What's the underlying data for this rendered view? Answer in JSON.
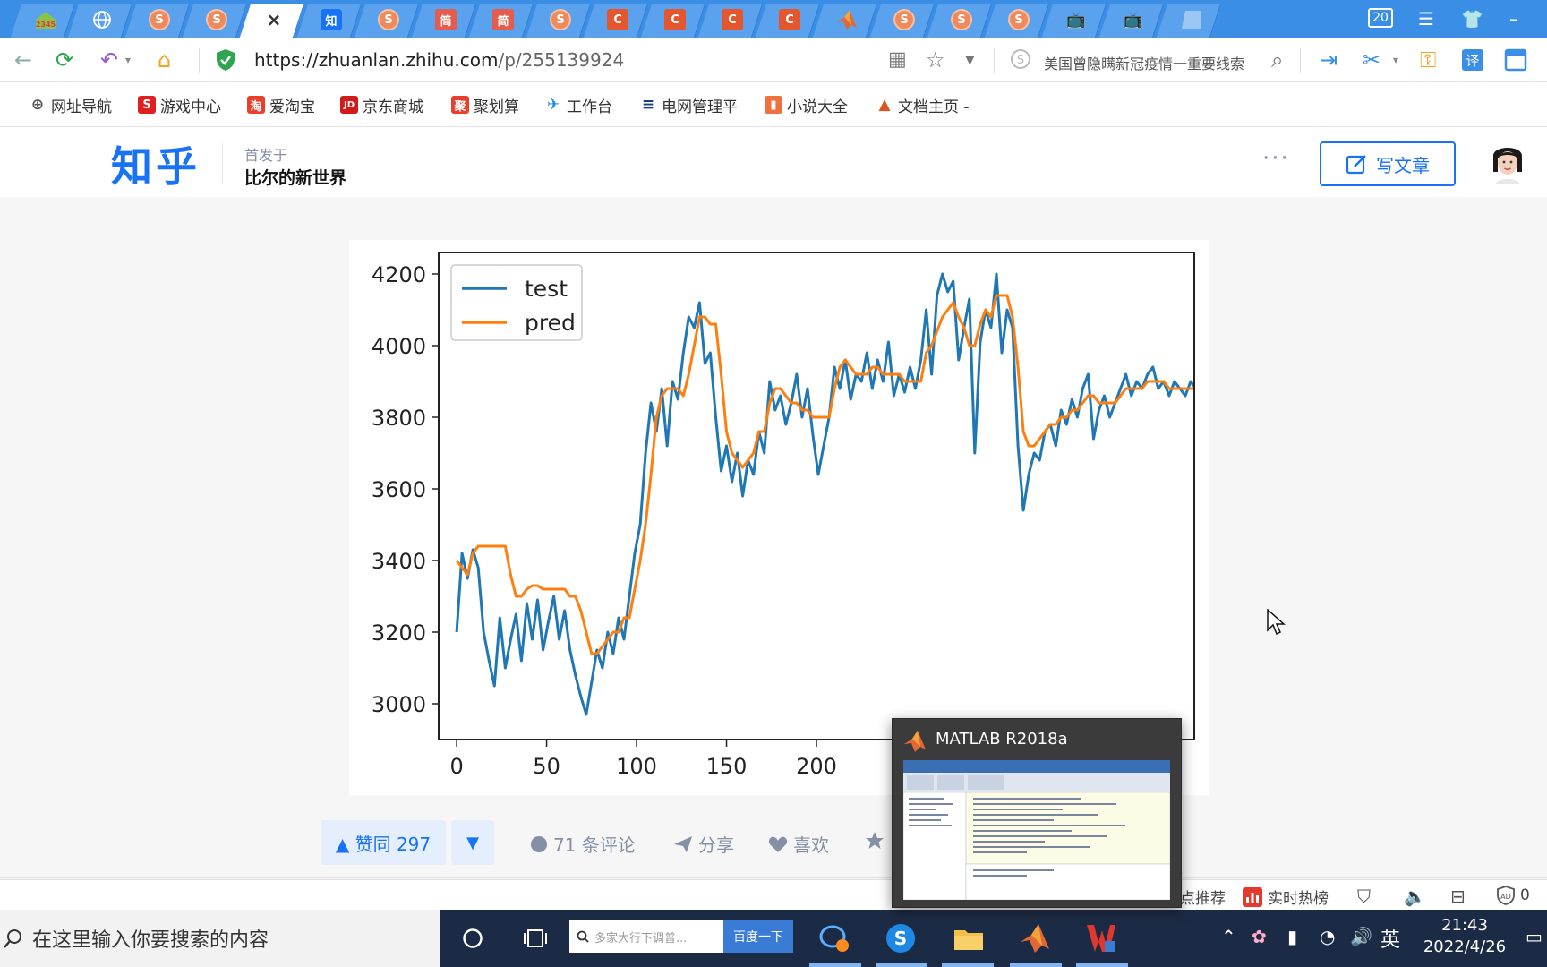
{
  "browser": {
    "tab_count": "20",
    "tabs": [
      {
        "icon": "home-2345",
        "text": ""
      },
      {
        "icon": "globe",
        "text": ""
      },
      {
        "icon": "sogou",
        "text": "S"
      },
      {
        "icon": "sogou",
        "text": "S"
      },
      {
        "icon": "close",
        "text": "×"
      },
      {
        "icon": "zhihu",
        "text": "知"
      },
      {
        "icon": "sogou",
        "text": "S"
      },
      {
        "icon": "jianshu",
        "text": "简"
      },
      {
        "icon": "jianshu",
        "text": "简"
      },
      {
        "icon": "sogou",
        "text": "S"
      },
      {
        "icon": "csdn",
        "text": "C"
      },
      {
        "icon": "csdn",
        "text": "C"
      },
      {
        "icon": "csdn",
        "text": "C"
      },
      {
        "icon": "csdn",
        "text": "C"
      },
      {
        "icon": "matlab",
        "text": ""
      },
      {
        "icon": "sogou",
        "text": "S"
      },
      {
        "icon": "sogou",
        "text": "S"
      },
      {
        "icon": "sogou",
        "text": "S"
      },
      {
        "icon": "bilibili",
        "text": "📺"
      },
      {
        "icon": "bilibili",
        "text": "📺"
      },
      {
        "icon": "blank",
        "text": ""
      }
    ],
    "url_host": "https://zhuanlan.zhihu.com",
    "url_path": "/p/255139924",
    "search_text": "美国曾隐瞒新冠疫情一重要线索"
  },
  "bookmarks": [
    {
      "label": "网址导航",
      "icon": "globe-icon",
      "icon_char": "⊕",
      "color": "#555555"
    },
    {
      "label": "游戏中心",
      "icon": "game-icon",
      "icon_char": "S",
      "color": "#e02020"
    },
    {
      "label": "爱淘宝",
      "icon": "taobao-icon",
      "icon_char": "淘",
      "color": "#e8402c"
    },
    {
      "label": "京东商城",
      "icon": "jd-icon",
      "icon_char": "JD",
      "color": "#d21a1a"
    },
    {
      "label": "聚划算",
      "icon": "juhuasuan-icon",
      "icon_char": "聚",
      "color": "#e8402c"
    },
    {
      "label": "工作台",
      "icon": "plane-icon",
      "icon_char": "✈",
      "color": "#1e88e5"
    },
    {
      "label": "电网管理平",
      "icon": "grid-icon",
      "icon_char": "≡",
      "color": "#1a3c8c"
    },
    {
      "label": "小说大全",
      "icon": "novel-icon",
      "icon_char": "▮",
      "color": "#f07040"
    },
    {
      "label": "文档主页 -",
      "icon": "matlab-icon",
      "icon_char": "▲",
      "color": "#d9541e"
    }
  ],
  "zhihu": {
    "logo": "知乎",
    "published_in": "首发于",
    "column": "比尔的新世界",
    "more": "···",
    "write_button": "写文章"
  },
  "chart_data": {
    "type": "line",
    "xlim": [
      -10,
      410
    ],
    "ylim": [
      2900,
      4260
    ],
    "x_ticks": [
      0,
      50,
      100,
      150,
      200
    ],
    "y_ticks": [
      3000,
      3200,
      3400,
      3600,
      3800,
      4000,
      4200
    ],
    "x_tick_labels": [
      "0",
      "50",
      "100",
      "150",
      "200"
    ],
    "y_tick_labels": [
      "3000",
      "3200",
      "3400",
      "3600",
      "3800",
      "4000",
      "4200"
    ],
    "legend_position": "upper-left",
    "series": [
      {
        "name": "test",
        "color": "#1f77b4",
        "x": [
          0,
          3,
          6,
          9,
          12,
          15,
          18,
          21,
          24,
          27,
          30,
          33,
          36,
          39,
          42,
          45,
          48,
          51,
          54,
          57,
          60,
          63,
          66,
          69,
          72,
          75,
          78,
          81,
          84,
          87,
          90,
          93,
          96,
          99,
          102,
          105,
          108,
          111,
          114,
          117,
          120,
          123,
          126,
          129,
          132,
          135,
          138,
          141,
          144,
          147,
          150,
          153,
          156,
          159,
          162,
          165,
          168,
          171,
          174,
          177,
          180,
          183,
          186,
          189,
          192,
          195,
          198,
          201,
          204,
          207,
          210,
          213,
          216,
          219,
          222,
          225,
          228,
          231,
          234,
          237,
          240,
          243,
          246,
          249,
          252,
          255,
          258,
          261,
          264,
          267,
          270,
          273,
          276,
          279,
          282,
          285,
          288,
          291,
          294,
          297,
          300,
          303,
          306,
          309,
          312,
          315,
          318,
          321,
          324,
          327,
          330,
          333,
          336,
          339,
          342,
          345,
          348,
          351,
          354,
          357,
          360,
          363,
          366,
          369,
          372,
          375,
          378,
          381,
          384,
          387,
          390,
          393,
          396,
          399,
          402,
          405,
          408,
          411,
          414
        ],
        "values": [
          3200,
          3420,
          3350,
          3430,
          3380,
          3200,
          3120,
          3050,
          3240,
          3100,
          3180,
          3250,
          3120,
          3280,
          3180,
          3290,
          3150,
          3230,
          3300,
          3180,
          3260,
          3150,
          3080,
          3020,
          2970,
          3060,
          3150,
          3100,
          3200,
          3140,
          3240,
          3180,
          3300,
          3420,
          3500,
          3700,
          3840,
          3760,
          3880,
          3720,
          3900,
          3850,
          3980,
          4080,
          4050,
          4120,
          3950,
          3980,
          3800,
          3650,
          3720,
          3620,
          3700,
          3580,
          3680,
          3640,
          3760,
          3700,
          3900,
          3820,
          3860,
          3780,
          3840,
          3920,
          3800,
          3880,
          3750,
          3640,
          3720,
          3800,
          3940,
          3880,
          3960,
          3850,
          3920,
          3900,
          3980,
          3880,
          3960,
          3900,
          4010,
          3860,
          3920,
          3870,
          3940,
          3880,
          3960,
          4100,
          3920,
          4140,
          4200,
          4150,
          4180,
          3960,
          4050,
          4130,
          3700,
          4010,
          4100,
          4050,
          4200,
          3980,
          4100,
          4050,
          3720,
          3540,
          3640,
          3700,
          3680,
          3760,
          3780,
          3720,
          3820,
          3780,
          3850,
          3800,
          3880,
          3920,
          3740,
          3820,
          3860,
          3800,
          3840,
          3880,
          3920,
          3860,
          3900,
          3880,
          3920,
          3940,
          3880,
          3900,
          3860,
          3900,
          3880,
          3860,
          3900,
          3880,
          3920
        ],
        "x_end_note": "series continues beyond visible window"
      },
      {
        "name": "pred",
        "color": "#ff7f0e",
        "x": [
          0,
          3,
          6,
          9,
          12,
          15,
          18,
          21,
          24,
          27,
          30,
          33,
          36,
          39,
          42,
          45,
          48,
          51,
          54,
          57,
          60,
          63,
          66,
          69,
          72,
          75,
          78,
          81,
          84,
          87,
          90,
          93,
          96,
          99,
          102,
          105,
          108,
          111,
          114,
          117,
          120,
          123,
          126,
          129,
          132,
          135,
          138,
          141,
          144,
          147,
          150,
          153,
          156,
          159,
          162,
          165,
          168,
          171,
          174,
          177,
          180,
          183,
          186,
          189,
          192,
          195,
          198,
          201,
          204,
          207,
          210,
          213,
          216,
          219,
          222,
          225,
          228,
          231,
          234,
          237,
          240,
          243,
          246,
          249,
          252,
          255,
          258,
          261,
          264,
          267,
          270,
          273,
          276,
          279,
          282,
          285,
          288,
          291,
          294,
          297,
          300,
          303,
          306,
          309,
          312,
          315,
          318,
          321,
          324,
          327,
          330,
          333,
          336,
          339,
          342,
          345,
          348,
          351,
          354,
          357,
          360,
          363,
          366,
          369,
          372,
          375,
          378,
          381,
          384,
          387,
          390,
          393,
          396,
          399,
          402,
          405,
          408,
          411,
          414
        ],
        "values": [
          3400,
          3380,
          3360,
          3420,
          3440,
          3440,
          3440,
          3440,
          3440,
          3440,
          3360,
          3300,
          3300,
          3320,
          3330,
          3330,
          3320,
          3320,
          3320,
          3320,
          3320,
          3300,
          3300,
          3260,
          3200,
          3140,
          3140,
          3160,
          3180,
          3200,
          3200,
          3240,
          3240,
          3320,
          3400,
          3500,
          3640,
          3800,
          3860,
          3880,
          3880,
          3880,
          3860,
          3920,
          4000,
          4080,
          4080,
          4060,
          4060,
          3920,
          3760,
          3700,
          3680,
          3660,
          3680,
          3700,
          3760,
          3760,
          3840,
          3880,
          3880,
          3860,
          3840,
          3840,
          3820,
          3820,
          3800,
          3800,
          3800,
          3800,
          3880,
          3940,
          3960,
          3940,
          3920,
          3920,
          3920,
          3940,
          3940,
          3920,
          3920,
          3920,
          3920,
          3900,
          3900,
          3900,
          3900,
          3980,
          4000,
          4040,
          4080,
          4100,
          4120,
          4080,
          4050,
          4000,
          4000,
          4060,
          4100,
          4080,
          4140,
          4140,
          4140,
          4080,
          3940,
          3760,
          3720,
          3720,
          3740,
          3760,
          3780,
          3780,
          3800,
          3800,
          3820,
          3820,
          3840,
          3860,
          3860,
          3840,
          3840,
          3840,
          3840,
          3860,
          3880,
          3880,
          3880,
          3880,
          3900,
          3900,
          3900,
          3900,
          3880,
          3880,
          3880,
          3880,
          3880,
          3880,
          3880
        ]
      }
    ]
  },
  "actions": {
    "upvote": "▲ 赞同 297",
    "downvote": "▼",
    "comments": "71 条评论",
    "share": "分享",
    "like": "喜欢"
  },
  "statusbar": {
    "recommend": "点推荐",
    "hot": "实时热榜",
    "ad_count": "0"
  },
  "taskbar": {
    "search_placeholder": "在这里输入你要搜索的内容",
    "box_text": "多家大行下调普...",
    "box_button": "百度一下",
    "ime": "英",
    "time": "21:43",
    "date": "2022/4/26"
  },
  "matlab_preview": {
    "title": "MATLAB R2018a"
  }
}
